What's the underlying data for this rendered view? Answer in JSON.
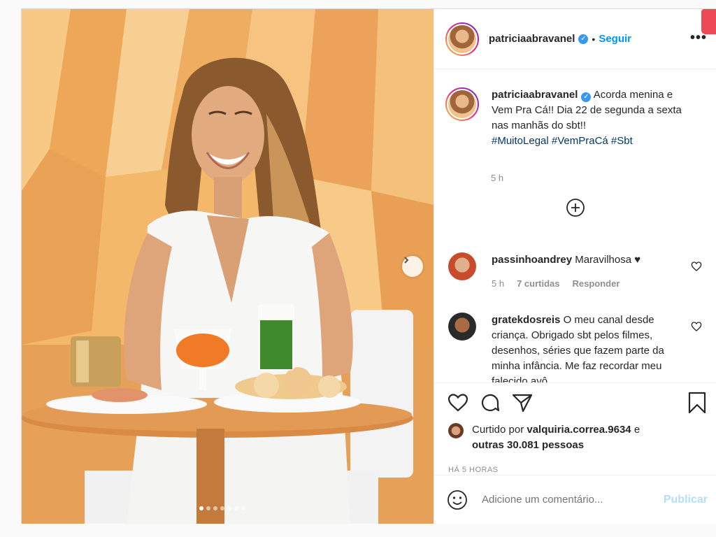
{
  "post": {
    "author": "patriciaabravanel",
    "follow_label": "Seguir",
    "separator": "•",
    "more_label": "•••",
    "caption": {
      "text": "Acorda menina e Vem Pra Cá!! Dia 22 de segunda a sexta nas manhãs do sbt!!",
      "hashtags": "#MuitoLegal #VemPraCá #Sbt",
      "time": "5 h"
    },
    "comments": [
      {
        "user": "passinhoandrey",
        "text": "Maravilhosa ♥",
        "time": "5 h",
        "likes": "7 curtidas",
        "reply": "Responder"
      },
      {
        "user": "gratekdosreis",
        "text": "O meu canal desde criança. Obrigado sbt pelos filmes, desenhos, séries que fazem parte da minha infância. Me faz recordar meu falecido avô"
      }
    ],
    "liked_by_prefix": "Curtido por",
    "liked_by_user": "valquiria.correa.9634",
    "liked_by_and": "e",
    "liked_by_others": "outras 30.081 pessoas",
    "age": "HÁ 5 HORAS",
    "comment_placeholder": "Adicione um comentário...",
    "publish_label": "Publicar",
    "carousel_count": 7,
    "carousel_active": 0
  },
  "icons": [
    "heart-icon",
    "comment-icon",
    "share-icon",
    "bookmark-icon",
    "emoji-icon",
    "plus-circle-icon",
    "chevron-right-icon",
    "verified-badge-icon"
  ],
  "colors": {
    "link": "#0095f6",
    "hashtag": "#00376b",
    "muted": "#8e8e8e",
    "publish_disabled": "#b2dffc",
    "verified": "#3897f0"
  }
}
